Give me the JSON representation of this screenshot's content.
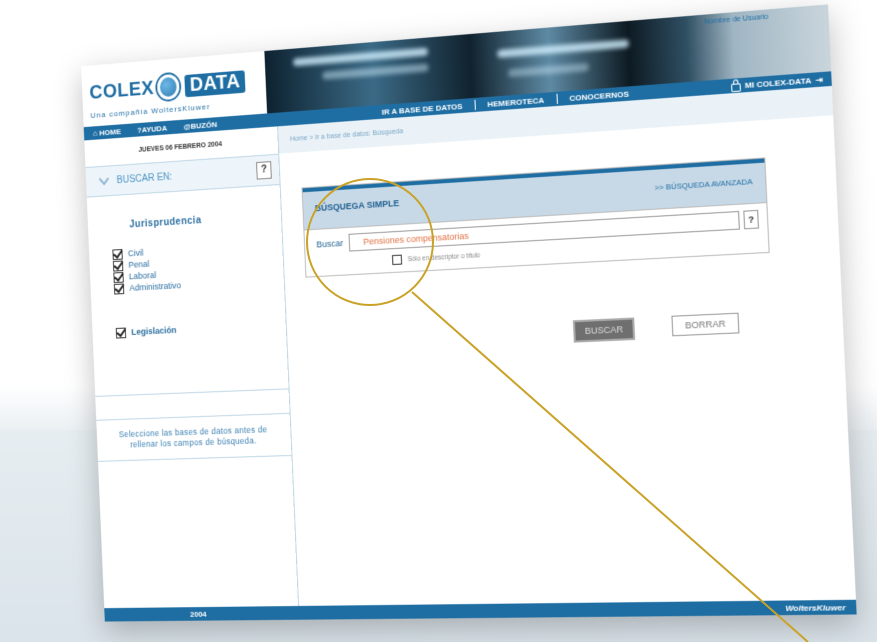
{
  "header": {
    "logo_left": "COLEX",
    "logo_right": "DATA",
    "tagline": "Una compañía WoltersKluwer",
    "user_label": "Nombre de Usuario"
  },
  "nav": {
    "home": "HOME",
    "ayuda": "?AYUDA",
    "buzon": "@BUZÓN",
    "items": [
      "IR A BASE DE DATOS",
      "HEMEROTECA",
      "CONOCERNOS"
    ],
    "mi_colex": "MI COLEX-DATA"
  },
  "sidebar": {
    "date": "JUEVES 06 FEBRERO 2004",
    "buscar_en": "BUSCAR EN:",
    "help": "?",
    "jurisprudencia_title": "Jurisprudencia",
    "jurisprudencia": [
      "Civil",
      "Penal",
      "Laboral",
      "Administrativo"
    ],
    "legislacion": "Legislación",
    "note": "Seleccione las bases de datos antes de rellenar los campos de búsqueda."
  },
  "main": {
    "breadcrumb": "Home > Ir a base de datos: Búsqueda",
    "simple_tab": "BÚSQUEGA SIMPLE",
    "advanced_link": ">> BÚSQUEDA AVANZADA",
    "buscar_label": "Buscar",
    "search_value": "Pensiones compensatorias",
    "field_help": "?",
    "title_only": "Sólo en descriptor o título",
    "buscar_button": "BUSCAR",
    "borrar_button": "BORRAR"
  },
  "footer": {
    "year": "2004",
    "brand": "WoltersKluwer"
  },
  "colors": {
    "brand_blue": "#1f6ea3",
    "highlight": "#c9a227",
    "search_text": "#e07040"
  }
}
